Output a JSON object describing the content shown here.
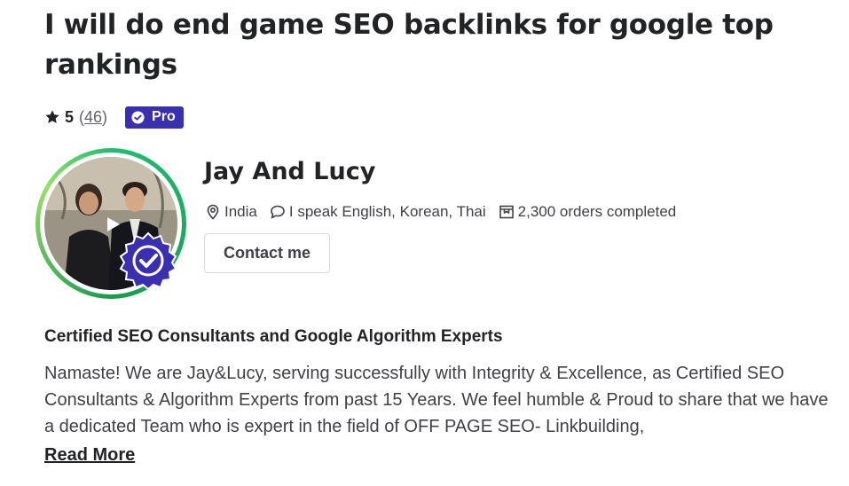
{
  "gig": {
    "title": "I will do end game SEO backlinks for google top rankings"
  },
  "rating": {
    "score": "5",
    "count_open": "(",
    "count": "46",
    "count_close": ")",
    "star_icon": "star-icon"
  },
  "badge": {
    "label": "Pro",
    "icon": "pro-check-icon",
    "color": "#3a2fb0"
  },
  "seller": {
    "name": "Jay And Lucy",
    "location": "India",
    "languages": "I speak English, Korean, Thai",
    "orders": "2,300 orders completed",
    "contact_label": "Contact me",
    "ring_color": "#1dbf73",
    "verified_color": "#3a2fb0"
  },
  "about": {
    "heading": "Certified SEO Consultants and Google Algorithm Experts",
    "text": "Namaste! We are Jay&Lucy, serving successfully with Integrity & Excellence, as Certified SEO Consultants & Algorithm Experts from past 15 Years. We feel humble & Proud to share that we have a dedicated Team who is expert in the field of OFF PAGE SEO- Linkbuilding,",
    "read_more": "Read More"
  }
}
